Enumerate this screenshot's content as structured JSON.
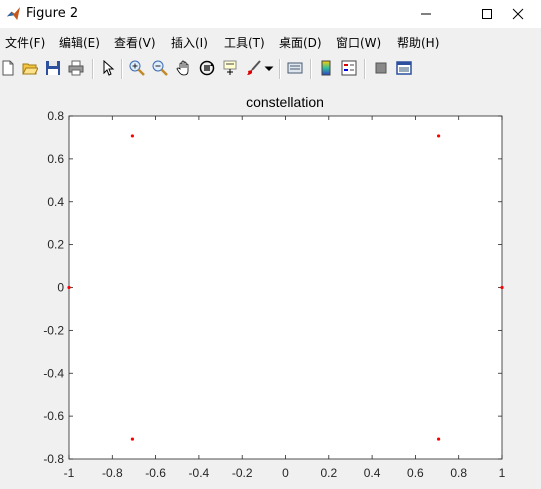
{
  "window": {
    "title": "Figure 2",
    "controls": {
      "minimize": "—",
      "maximize": "☐",
      "close": "✕"
    }
  },
  "menu": {
    "items": [
      "文件(F)",
      "编辑(E)",
      "查看(V)",
      "插入(I)",
      "工具(T)",
      "桌面(D)",
      "窗口(W)",
      "帮助(H)"
    ]
  },
  "toolbar": {
    "icons": [
      "new-figure-icon",
      "open-icon",
      "save-icon",
      "print-icon",
      "pointer-icon",
      "zoom-in-icon",
      "zoom-out-icon",
      "pan-icon",
      "rotate-3d-icon",
      "data-cursor-icon",
      "brush-icon",
      "brush-dropdown-icon",
      "link-plot-icon",
      "colorbar-icon",
      "legend-icon",
      "hide-plot-tools-icon",
      "show-plot-tools-icon"
    ]
  },
  "colors": {
    "marker": "#ff0000",
    "axes_bg": "#ffffff",
    "figure_bg": "#f0f0f0"
  },
  "chart_data": {
    "type": "scatter",
    "title": "constellation",
    "xlabel": "",
    "ylabel": "",
    "xlim": [
      -1,
      1
    ],
    "ylim": [
      -0.8,
      0.8
    ],
    "xticks": [
      -1,
      -0.8,
      -0.6,
      -0.4,
      -0.2,
      0,
      0.2,
      0.4,
      0.6,
      0.8,
      1
    ],
    "xtick_labels": [
      "-1",
      "-0.8",
      "-0.6",
      "-0.4",
      "-0.2",
      "0",
      "0.2",
      "0.4",
      "0.6",
      "0.8",
      "1"
    ],
    "yticks": [
      -0.8,
      -0.6,
      -0.4,
      -0.2,
      0,
      0.2,
      0.4,
      0.6,
      0.8
    ],
    "ytick_labels": [
      "-0.8",
      "-0.6",
      "-0.4",
      "-0.2",
      "0",
      "0.2",
      "0.4",
      "0.6",
      "0.8"
    ],
    "grid": false,
    "series": [
      {
        "points": [
          {
            "x": 1,
            "y": 0
          },
          {
            "x": 0.7071,
            "y": 0.7071
          },
          {
            "x": -0.7071,
            "y": 0.7071
          },
          {
            "x": -1,
            "y": 0
          },
          {
            "x": -0.7071,
            "y": -0.7071
          },
          {
            "x": 0.7071,
            "y": -0.7071
          }
        ]
      }
    ]
  }
}
